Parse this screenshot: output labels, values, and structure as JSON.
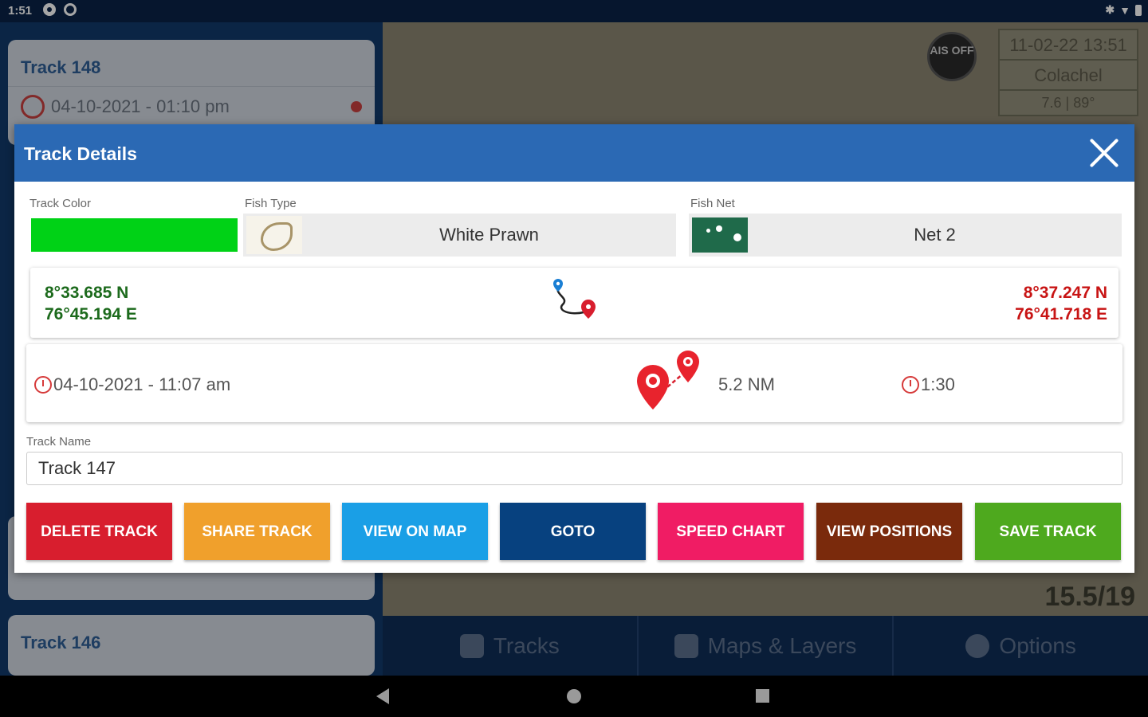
{
  "status_bar": {
    "time": "1:51"
  },
  "background_list": {
    "cards": [
      {
        "title": "Track 148",
        "datetime": "04-10-2021 - 01:10 pm"
      },
      {
        "title": "Track 146"
      }
    ]
  },
  "map_overlay": {
    "ais_label": "AIS OFF",
    "datetime": "11-02-22 13:51",
    "location": "Colachel",
    "speed_heading": "7.6 | 89°",
    "speed_readout": "15.5/19"
  },
  "app_nav": {
    "tracks": "Tracks",
    "maps_layers": "Maps & Layers",
    "options": "Options"
  },
  "dialog": {
    "title": "Track Details",
    "labels": {
      "track_color": "Track Color",
      "fish_type": "Fish Type",
      "fish_net": "Fish Net",
      "track_name": "Track Name"
    },
    "track_color": "#00d216",
    "fish_type": "White Prawn",
    "fish_net": "Net 2",
    "start": {
      "lat": "8°33.685 N",
      "lon": "76°45.194 E"
    },
    "end": {
      "lat": "8°37.247 N",
      "lon": "76°41.718 E"
    },
    "start_datetime": "04-10-2021 - 11:07 am",
    "distance": "5.2 NM",
    "duration": "1:30",
    "track_name_value": "Track 147"
  },
  "buttons": [
    {
      "label": "Delete Track",
      "color": "#d81e2e"
    },
    {
      "label": "Share Track",
      "color": "#f0a02c"
    },
    {
      "label": "View on Map",
      "color": "#1a9fe6"
    },
    {
      "label": "Goto",
      "color": "#07417f"
    },
    {
      "label": "Speed Chart",
      "color": "#f01c64"
    },
    {
      "label": "View Positions",
      "color": "#7a2a0c"
    },
    {
      "label": "Save Track",
      "color": "#4ea91e"
    }
  ]
}
